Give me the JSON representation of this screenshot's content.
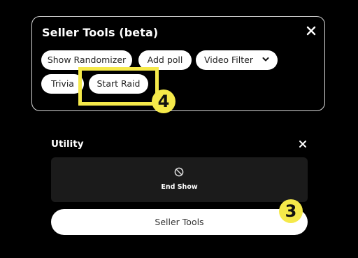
{
  "seller_tools": {
    "title": "Seller Tools (beta)",
    "close_icon": "close-icon",
    "chips": {
      "show_randomizer": "Show Randomizer",
      "add_poll": "Add poll",
      "video_filter": "Video Filter",
      "trivia": "Trivia",
      "start_raid": "Start Raid"
    }
  },
  "utility": {
    "title": "Utility",
    "close_icon": "close-icon",
    "end_show": {
      "icon": "ban-icon",
      "label": "End Show"
    },
    "seller_tools_button": "Seller Tools"
  },
  "annotations": {
    "step_3": "3",
    "step_4": "4",
    "highlight_color": "#f5e94a"
  }
}
